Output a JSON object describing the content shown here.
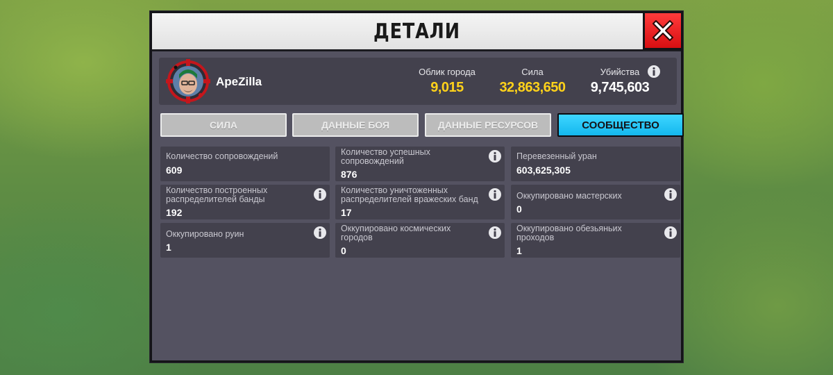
{
  "dialog": {
    "title": "ДЕТАЛИ",
    "close_icon": "close-x-icon"
  },
  "player": {
    "name": "ApeZilla",
    "avatar_icon": "crosshair-avatar-icon"
  },
  "stats": [
    {
      "label": "Облик города",
      "value": "9,015",
      "color": "#ffd21a"
    },
    {
      "label": "Сила",
      "value": "32,863,650",
      "color": "#ffd21a"
    },
    {
      "label": "Убийства",
      "value": "9,745,603",
      "color": "#ffffff"
    }
  ],
  "tabs": [
    {
      "label": "СИЛА",
      "active": false
    },
    {
      "label": "ДАННЫЕ БОЯ",
      "active": false
    },
    {
      "label": "ДАННЫЕ РЕСУРСОВ",
      "active": false
    },
    {
      "label": "СООБЩЕСТВО",
      "active": true
    }
  ],
  "cards": [
    {
      "label": "Количество сопровождений",
      "value": "609",
      "info": false
    },
    {
      "label": "Количество успешных сопровождений",
      "value": "876",
      "info": true
    },
    {
      "label": "Перевезенный уран",
      "value": "603,625,305",
      "info": false
    },
    {
      "label": "Количество построенных распределителей банды",
      "value": "192",
      "info": true
    },
    {
      "label": "Количество уничтоженных распределителей вражеских банд",
      "value": "17",
      "info": true
    },
    {
      "label": "Оккупировано мастерских",
      "value": "0",
      "info": true
    },
    {
      "label": "Оккупировано руин",
      "value": "1",
      "info": true
    },
    {
      "label": "Оккупировано космических городов",
      "value": "0",
      "info": true
    },
    {
      "label": "Оккупировано обезьяньих проходов",
      "value": "1",
      "info": true
    }
  ],
  "colors": {
    "panel": "#545261",
    "card": "#43414d",
    "accent_tab": "#14b8ee",
    "close_button": "#e01518",
    "highlight_value": "#ffd21a"
  }
}
